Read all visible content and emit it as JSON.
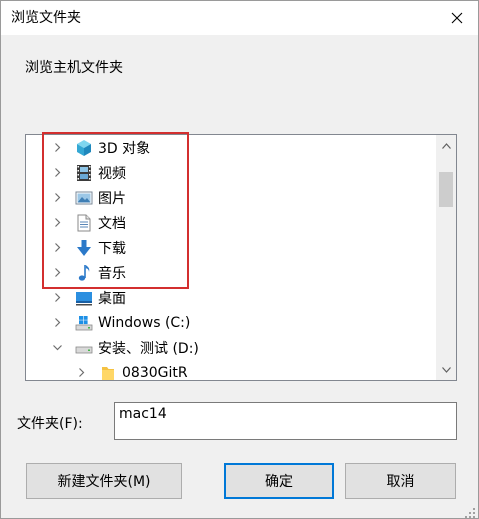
{
  "window": {
    "title": "浏览文件夹"
  },
  "dialog": {
    "subtitle": "浏览主机文件夹"
  },
  "tree": {
    "items": [
      {
        "label": "3D 对象",
        "icon": "cube-3d-icon",
        "expanded": false
      },
      {
        "label": "视频",
        "icon": "video-icon",
        "expanded": false
      },
      {
        "label": "图片",
        "icon": "pictures-icon",
        "expanded": false
      },
      {
        "label": "文档",
        "icon": "document-icon",
        "expanded": false
      },
      {
        "label": "下载",
        "icon": "download-icon",
        "expanded": false
      },
      {
        "label": "音乐",
        "icon": "music-icon",
        "expanded": false
      },
      {
        "label": "桌面",
        "icon": "desktop-icon",
        "expanded": false
      },
      {
        "label": "Windows (C:)",
        "icon": "windows-drive-icon",
        "expanded": false
      },
      {
        "label": "安装、测试 (D:)",
        "icon": "drive-icon",
        "expanded": true
      },
      {
        "label": "0830GitR",
        "icon": "folder-icon",
        "expanded": false
      }
    ]
  },
  "folder": {
    "label": "文件夹(F):",
    "value": "mac14"
  },
  "buttons": {
    "new_folder": "新建文件夹(M)",
    "ok": "确定",
    "cancel": "取消"
  },
  "colors": {
    "accent": "#0078d7",
    "highlight": "#d32f2f"
  }
}
